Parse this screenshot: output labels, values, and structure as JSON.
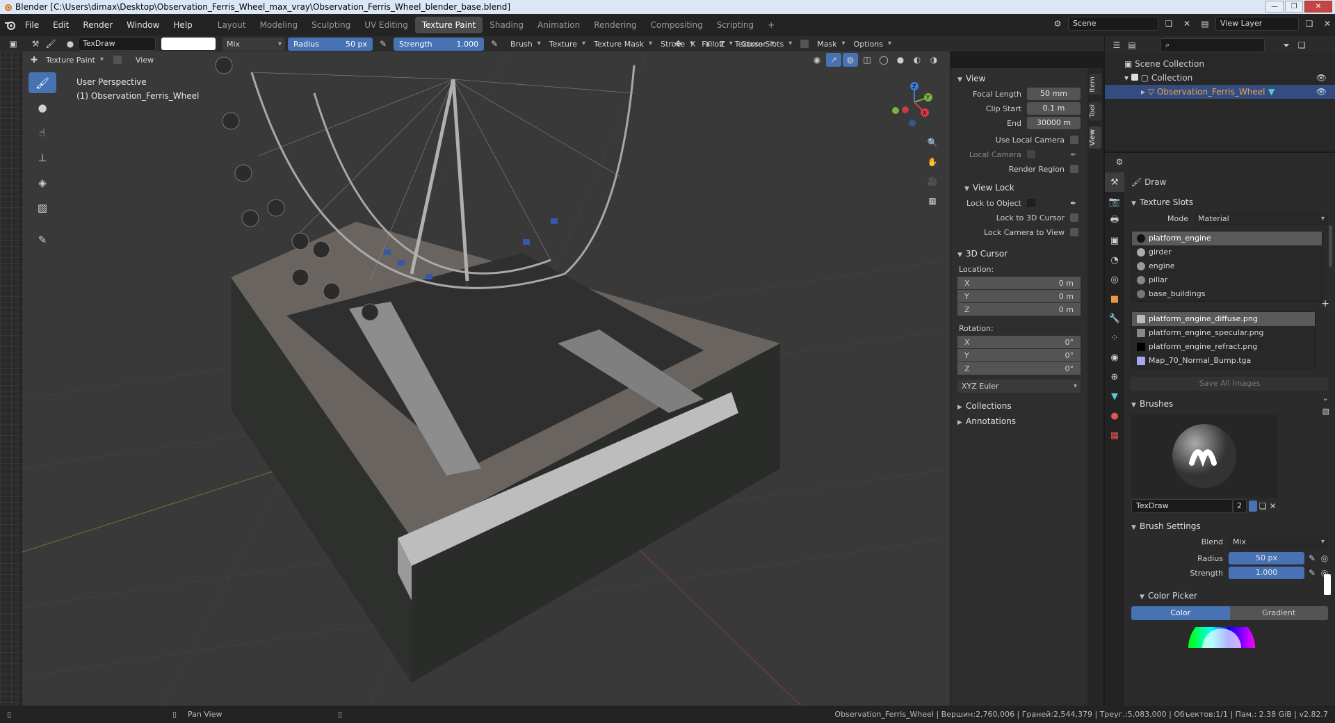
{
  "window": {
    "title": "Blender [C:\\Users\\dimax\\Desktop\\Observation_Ferris_Wheel_max_vray\\Observation_Ferris_Wheel_blender_base.blend]",
    "controls": [
      "—",
      "❐",
      "✕"
    ]
  },
  "menu": [
    "File",
    "Edit",
    "Render",
    "Window",
    "Help"
  ],
  "workspaces": [
    "Layout",
    "Modeling",
    "Sculpting",
    "UV Editing",
    "Texture Paint",
    "Shading",
    "Animation",
    "Rendering",
    "Compositing",
    "Scripting",
    "+"
  ],
  "active_workspace": "Texture Paint",
  "scene": {
    "label": "Scene",
    "view_layer": "View Layer"
  },
  "tool_header": {
    "brush_name": "TexDraw",
    "blend": "Mix",
    "radius_label": "Radius",
    "radius_value": "50 px",
    "strength_label": "Strength",
    "strength_value": "1.000",
    "menus": [
      "Brush",
      "Texture",
      "Texture Mask",
      "Stroke",
      "Falloff",
      "Cursor"
    ],
    "axes": [
      "X",
      "Y",
      "Z"
    ],
    "right_menus": [
      "Texture Slots",
      "Mask",
      "Options"
    ]
  },
  "viewport_header": {
    "mode": "Texture Paint",
    "view": "View"
  },
  "viewport": {
    "perspective": "User Perspective",
    "object": "(1) Observation_Ferris_Wheel"
  },
  "npanel": {
    "view_section": "View",
    "focal_length_label": "Focal Length",
    "focal_length": "50 mm",
    "clip_start_label": "Clip Start",
    "clip_start": "0.1 m",
    "end_label": "End",
    "end": "30000 m",
    "use_local_camera": "Use Local Camera",
    "local_camera": "Local Camera",
    "render_region": "Render Region",
    "view_lock": "View Lock",
    "lock_to_object": "Lock to Object",
    "lock_to_3d_cursor": "Lock to 3D Cursor",
    "lock_camera_to_view": "Lock Camera to View",
    "cursor_section": "3D Cursor",
    "location": "Location:",
    "loc": [
      {
        "axis": "X",
        "value": "0 m"
      },
      {
        "axis": "Y",
        "value": "0 m"
      },
      {
        "axis": "Z",
        "value": "0 m"
      }
    ],
    "rotation": "Rotation:",
    "rot": [
      {
        "axis": "X",
        "value": "0°"
      },
      {
        "axis": "Y",
        "value": "0°"
      },
      {
        "axis": "Z",
        "value": "0°"
      }
    ],
    "rotation_mode": "XYZ Euler",
    "collections": "Collections",
    "annotations": "Annotations",
    "tabs": [
      "Item",
      "Tool",
      "View"
    ]
  },
  "outliner": {
    "scene_collection": "Scene Collection",
    "collection": "Collection",
    "object": "Observation_Ferris_Wheel"
  },
  "properties": {
    "draw": "Draw",
    "texture_slots": "Texture Slots",
    "mode_label": "Mode",
    "mode": "Material",
    "materials": [
      "platform_engine",
      "girder",
      "engine",
      "pillar",
      "base_buildings"
    ],
    "images": [
      "platform_engine_diffuse.png",
      "platform_engine_specular.png",
      "platform_engine_refract.png",
      "Map_70_Normal_Bump.tga"
    ],
    "save_all": "Save All Images",
    "brushes": "Brushes",
    "brush_name": "TexDraw",
    "brush_users": "2",
    "brush_settings": "Brush Settings",
    "blend_label": "Blend",
    "blend": "Mix",
    "radius_label": "Radius",
    "radius": "50 px",
    "strength_label": "Strength",
    "strength": "1.000",
    "color_picker": "Color Picker",
    "color_tab": "Color",
    "gradient_tab": "Gradient"
  },
  "statusbar": {
    "action": "Pan View",
    "stats": "Observation_Ferris_Wheel | Вершин:2,760,006 | Граней:2,544,379 | Треуг.:5,083,000 | Объектов:1/1 | Пам.: 2.38 GiB | v2.82.7"
  }
}
